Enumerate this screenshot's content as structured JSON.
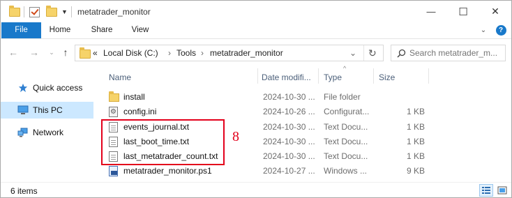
{
  "window": {
    "title": "metatrader_monitor",
    "minimize": "—",
    "maximize": "☐",
    "close": "✕"
  },
  "ribbon": {
    "tabs": [
      "File",
      "Home",
      "Share",
      "View"
    ],
    "expand_icon": "chevron-down-icon",
    "help_icon": "?"
  },
  "address": {
    "overflow": "«",
    "segments": [
      "Local Disk (C:)",
      "Tools",
      "metatrader_monitor"
    ],
    "separator": "›",
    "refresh": "↻"
  },
  "search": {
    "placeholder": "Search metatrader_m..."
  },
  "nav": {
    "items": [
      {
        "label": "Quick access",
        "icon": "star-icon"
      },
      {
        "label": "This PC",
        "icon": "pc-icon"
      },
      {
        "label": "Network",
        "icon": "network-icon"
      }
    ]
  },
  "list": {
    "headers": {
      "name": "Name",
      "date": "Date modifi...",
      "type": "Type",
      "size": "Size"
    },
    "sort_indicator": "^",
    "rows": [
      {
        "name": "install",
        "date": "2024-10-30 ...",
        "type": "File folder",
        "size": "",
        "icon": "folder-icon"
      },
      {
        "name": "config.ini",
        "date": "2024-10-26 ...",
        "type": "Configurat...",
        "size": "1 KB",
        "icon": "ini-file-icon"
      },
      {
        "name": "events_journal.txt",
        "date": "2024-10-30 ...",
        "type": "Text Docu...",
        "size": "1 KB",
        "icon": "text-file-icon"
      },
      {
        "name": "last_boot_time.txt",
        "date": "2024-10-30 ...",
        "type": "Text Docu...",
        "size": "1 KB",
        "icon": "text-file-icon"
      },
      {
        "name": "last_metatrader_count.txt",
        "date": "2024-10-30 ...",
        "type": "Text Docu...",
        "size": "1 KB",
        "icon": "text-file-icon"
      },
      {
        "name": "metatrader_monitor.ps1",
        "date": "2024-10-27 ...",
        "type": "Windows ...",
        "size": "9 KB",
        "icon": "powershell-file-icon"
      }
    ]
  },
  "annotation": {
    "label": "8",
    "color": "#e3001b"
  },
  "status": {
    "count": "6 items"
  },
  "colors": {
    "accent": "#1979ca",
    "selection": "#cce8ff",
    "header_text": "#4c607a"
  }
}
